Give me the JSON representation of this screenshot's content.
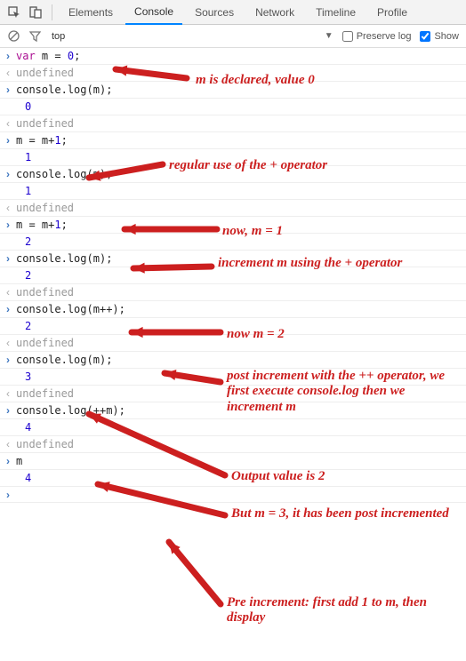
{
  "tabs": {
    "elements": "Elements",
    "console": "Console",
    "sources": "Sources",
    "network": "Network",
    "timeline": "Timeline",
    "profiles": "Profile"
  },
  "toolbar": {
    "context": "top",
    "preserve_label": "Preserve log",
    "show_label": "Show"
  },
  "lines": [
    {
      "type": "input",
      "tokens": [
        [
          "kw",
          "var"
        ],
        [
          "punc",
          " "
        ],
        [
          "ident",
          "m"
        ],
        [
          "punc",
          " = "
        ],
        [
          "num",
          "0"
        ],
        [
          "punc",
          ";"
        ]
      ]
    },
    {
      "type": "result",
      "text": "undefined"
    },
    {
      "type": "input",
      "tokens": [
        [
          "ident",
          "console"
        ],
        [
          "punc",
          "."
        ],
        [
          "func",
          "log"
        ],
        [
          "punc",
          "("
        ],
        [
          "ident",
          "m"
        ],
        [
          "punc",
          ");"
        ]
      ]
    },
    {
      "type": "output",
      "text": "0"
    },
    {
      "type": "result",
      "text": "undefined"
    },
    {
      "type": "input",
      "tokens": [
        [
          "ident",
          "m"
        ],
        [
          "punc",
          " = "
        ],
        [
          "ident",
          "m"
        ],
        [
          "punc",
          "+"
        ],
        [
          "num",
          "1"
        ],
        [
          "punc",
          ";"
        ]
      ]
    },
    {
      "type": "output",
      "text": "1"
    },
    {
      "type": "input",
      "tokens": [
        [
          "ident",
          "console"
        ],
        [
          "punc",
          "."
        ],
        [
          "func",
          "log"
        ],
        [
          "punc",
          "("
        ],
        [
          "ident",
          "m"
        ],
        [
          "punc",
          ");"
        ]
      ]
    },
    {
      "type": "output",
      "text": "1"
    },
    {
      "type": "result",
      "text": "undefined"
    },
    {
      "type": "input",
      "tokens": [
        [
          "ident",
          "m"
        ],
        [
          "punc",
          " = "
        ],
        [
          "ident",
          "m"
        ],
        [
          "punc",
          "+"
        ],
        [
          "num",
          "1"
        ],
        [
          "punc",
          ";"
        ]
      ]
    },
    {
      "type": "output",
      "text": "2"
    },
    {
      "type": "input",
      "tokens": [
        [
          "ident",
          "console"
        ],
        [
          "punc",
          "."
        ],
        [
          "func",
          "log"
        ],
        [
          "punc",
          "("
        ],
        [
          "ident",
          "m"
        ],
        [
          "punc",
          ");"
        ]
      ]
    },
    {
      "type": "output",
      "text": "2"
    },
    {
      "type": "result",
      "text": "undefined"
    },
    {
      "type": "input",
      "tokens": [
        [
          "ident",
          "console"
        ],
        [
          "punc",
          "."
        ],
        [
          "func",
          "log"
        ],
        [
          "punc",
          "("
        ],
        [
          "ident",
          "m"
        ],
        [
          "punc",
          "++);"
        ]
      ]
    },
    {
      "type": "output",
      "text": "2"
    },
    {
      "type": "result",
      "text": "undefined"
    },
    {
      "type": "input",
      "tokens": [
        [
          "ident",
          "console"
        ],
        [
          "punc",
          "."
        ],
        [
          "func",
          "log"
        ],
        [
          "punc",
          "("
        ],
        [
          "ident",
          "m"
        ],
        [
          "punc",
          ");"
        ]
      ]
    },
    {
      "type": "output",
      "text": "3"
    },
    {
      "type": "result",
      "text": "undefined"
    },
    {
      "type": "input",
      "tokens": [
        [
          "ident",
          "console"
        ],
        [
          "punc",
          "."
        ],
        [
          "func",
          "log"
        ],
        [
          "punc",
          "(++"
        ],
        [
          "ident",
          "m"
        ],
        [
          "punc",
          ");"
        ]
      ]
    },
    {
      "type": "output",
      "text": "4"
    },
    {
      "type": "result",
      "text": "undefined"
    },
    {
      "type": "input",
      "tokens": [
        [
          "ident",
          "m"
        ]
      ]
    },
    {
      "type": "output",
      "text": "4"
    },
    {
      "type": "prompt",
      "text": ""
    }
  ],
  "annotations": {
    "a1": "m is declared, value 0",
    "a2": "regular use of the + operator",
    "a3": "now, m = 1",
    "a4": "increment m using the + operator",
    "a5": "now m = 2",
    "a6": "post increment with the ++ operator, we first execute console.log then we increment m",
    "a7": "Output value is 2",
    "a8": "But m = 3, it has been post incremented",
    "a9": "Pre increment: first add 1 to m, then display"
  }
}
